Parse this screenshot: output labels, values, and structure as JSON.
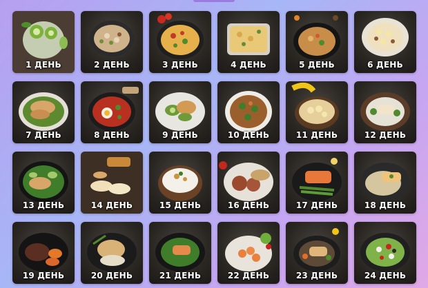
{
  "days": [
    {
      "label": "1 ДЕНЬ",
      "dish": "kiwi-chia-pudding"
    },
    {
      "label": "2 ДЕНЬ",
      "dish": "chicken-salad-bowl"
    },
    {
      "label": "3 ДЕНЬ",
      "dish": "vegetable-frittata"
    },
    {
      "label": "4 ДЕНЬ",
      "dish": "baked-casserole"
    },
    {
      "label": "5 ДЕНЬ",
      "dish": "pan-fried-vegetables"
    },
    {
      "label": "6 ДЕНЬ",
      "dish": "banana-oatmeal"
    },
    {
      "label": "7 ДЕНЬ",
      "dish": "chicken-with-greens"
    },
    {
      "label": "8 ДЕНЬ",
      "dish": "shakshuka"
    },
    {
      "label": "9 ДЕНЬ",
      "dish": "chicken-zucchini-plate"
    },
    {
      "label": "10 ДЕНЬ",
      "dish": "chicken-broccoli-plate"
    },
    {
      "label": "11 ДЕНЬ",
      "dish": "banana-porridge"
    },
    {
      "label": "12 ДЕНЬ",
      "dish": "fish-with-broccoli"
    },
    {
      "label": "13 ДЕНЬ",
      "dish": "chicken-avocado-plate"
    },
    {
      "label": "14 ДЕНЬ",
      "dish": "apple-slices-honey"
    },
    {
      "label": "15 ДЕНЬ",
      "dish": "cottage-cheese-bowl"
    },
    {
      "label": "16 ДЕНЬ",
      "dish": "patties-with-rice"
    },
    {
      "label": "17 ДЕНЬ",
      "dish": "salmon-asparagus"
    },
    {
      "label": "18 ДЕНЬ",
      "dish": "fish-with-rice"
    },
    {
      "label": "19 ДЕНЬ",
      "dish": "steak-sweet-potato"
    },
    {
      "label": "20 ДЕНЬ",
      "dish": "chicken-green-beans"
    },
    {
      "label": "21 ДЕНЬ",
      "dish": "salmon-with-greens"
    },
    {
      "label": "22 ДЕНЬ",
      "dish": "shrimp-salad"
    },
    {
      "label": "23 ДЕНЬ",
      "dish": "fish-with-vegetables"
    },
    {
      "label": "24 ДЕНЬ",
      "dish": "greek-salad"
    }
  ]
}
